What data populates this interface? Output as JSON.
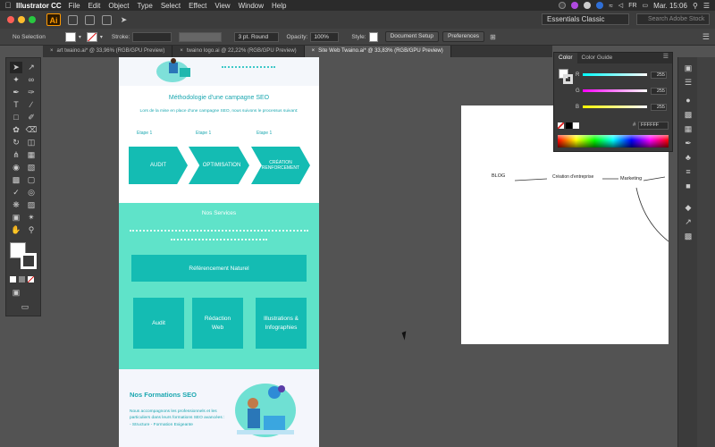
{
  "menubar": {
    "app_name": "Illustrator CC",
    "items": [
      "File",
      "Edit",
      "Object",
      "Type",
      "Select",
      "Effect",
      "View",
      "Window",
      "Help"
    ],
    "flag": "FR",
    "clock": "Mar. 15:06"
  },
  "appbar": {
    "logo": "Ai",
    "workspace": "Essentials Classic",
    "search_placeholder": "Search Adobe Stock"
  },
  "control": {
    "selection": "No Selection",
    "stroke_label": "Stroke:",
    "brush": "3 pt. Round",
    "opacity_label": "Opacity:",
    "opacity_value": "100%",
    "style_label": "Style:",
    "doc_setup": "Document Setup",
    "preferences": "Preferences"
  },
  "tabs": [
    {
      "label": "art twaino.ai* @ 33,96% (RGB/GPU Preview)"
    },
    {
      "label": "twaino logo.ai @ 22,22% (RGB/GPU Preview)"
    },
    {
      "label": "Site Web Twaino.ai* @ 33,83% (RGB/GPU Preview)"
    }
  ],
  "web": {
    "method_title": "Méthodologie d'une campagne SEO",
    "method_sub": "Lors de la mise en place d'une campagne SEO, nous suivons le processus suivant:",
    "steps": [
      {
        "label": "Etape 1",
        "name": "AUDIT"
      },
      {
        "label": "Etape 1",
        "name": "OPTIMISATION"
      },
      {
        "label": "Etape 1",
        "name": "CRÉATION RENFORCEMENT"
      }
    ],
    "services_title": "Nos Services",
    "services_wide": "Référencement Naturel",
    "services": [
      "Audit",
      "Rédaction Web",
      "Illustrations & Infographies"
    ],
    "formations_title": "Nos Formations SEO",
    "formations_text": "Nous accompagnons les professionnels et les particuliers dans leurs formations SEO avancées : - Structure - Formation Exigeante"
  },
  "mindmap": {
    "nodes": [
      "BLOG",
      "Création d'entreprise",
      "Marketing"
    ]
  },
  "colorpanel": {
    "tabs": [
      "Color",
      "Color Guide"
    ],
    "channels": [
      {
        "label": "R",
        "value": "255"
      },
      {
        "label": "G",
        "value": "255"
      },
      {
        "label": "B",
        "value": "255"
      }
    ],
    "hex_label": "#",
    "hex": "FFFFFF"
  }
}
